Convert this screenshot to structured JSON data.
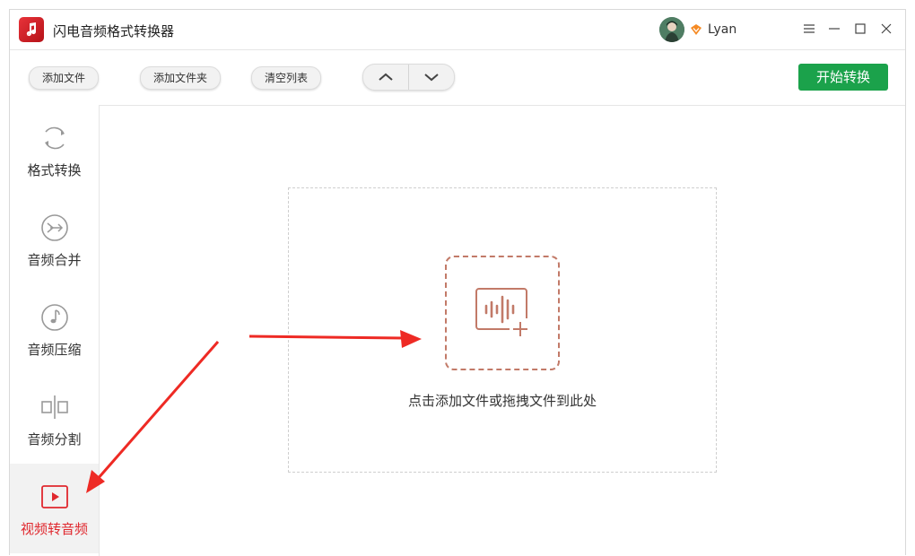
{
  "window": {
    "title": "闪电音频格式转换器",
    "user": {
      "name": "Lyan",
      "avatar": "avatar-image",
      "badge": "vip-diamond-icon"
    },
    "controls": [
      "menu-icon",
      "minimize-icon",
      "maximize-icon",
      "close-icon"
    ]
  },
  "toolbar": {
    "add_file": "添加文件",
    "add_folder": "添加文件夹",
    "clear_list": "清空列表",
    "move_up": "chevron-up-icon",
    "move_down": "chevron-down-icon",
    "start": "开始转换"
  },
  "sidebar": {
    "items": [
      {
        "label": "格式转换",
        "icon": "refresh-cycle-icon"
      },
      {
        "label": "音频合并",
        "icon": "merge-arrows-icon"
      },
      {
        "label": "音频压缩",
        "icon": "music-note-icon"
      },
      {
        "label": "音频分割",
        "icon": "split-icon"
      },
      {
        "label": "视频转音频",
        "icon": "video-play-icon",
        "active": true
      }
    ]
  },
  "dropzone": {
    "text": "点击添加文件或拖拽文件到此处",
    "icon": "audio-wave-add-icon"
  },
  "colors": {
    "accent_green": "#1ba24b",
    "active_red": "#e0282e",
    "drop_icon": "#c27a68",
    "annotation_arrow": "#ee2a24"
  }
}
